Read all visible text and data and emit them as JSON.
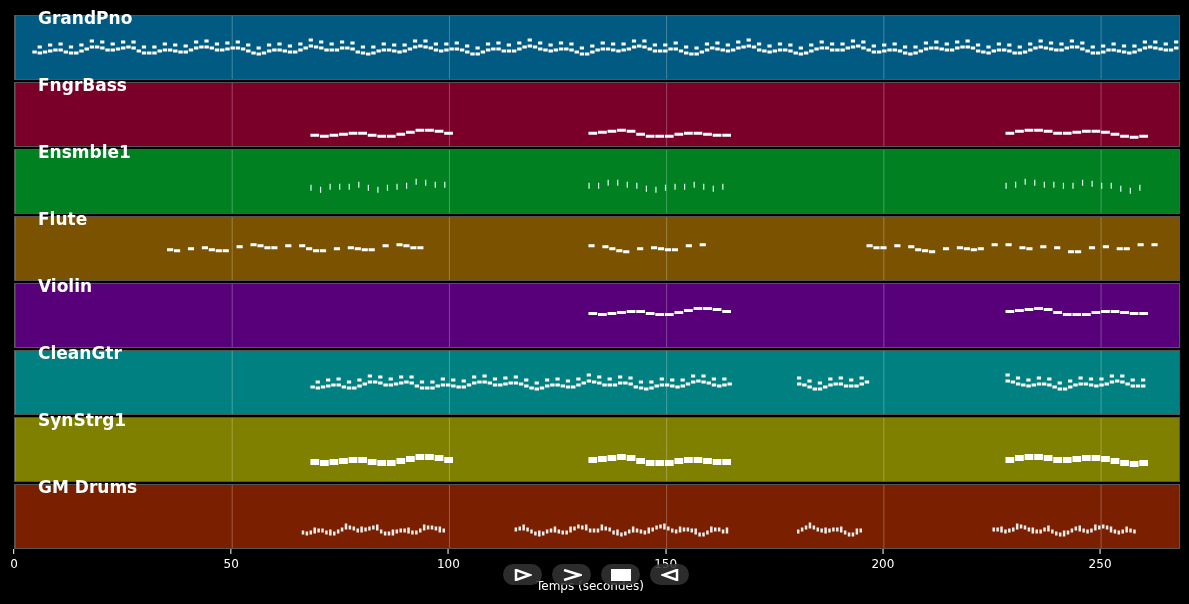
{
  "tracks": [
    {
      "name": "GrandPno",
      "color": "#005a82"
    },
    {
      "name": "FngrBass",
      "color": "#7a002a"
    },
    {
      "name": "Ensmble1",
      "color": "#008020"
    },
    {
      "name": "Flute",
      "color": "#7a5200"
    },
    {
      "name": "Violin",
      "color": "#57007a"
    },
    {
      "name": "CleanGtr",
      "color": "#008080"
    },
    {
      "name": "SynStrg1",
      "color": "#808000"
    },
    {
      "name": "GM Drums",
      "color": "#7a2000"
    }
  ],
  "x_axis": {
    "ticks": [
      "0",
      "50",
      "100",
      "150",
      "200",
      "250"
    ],
    "label": "Temps (secondes)"
  },
  "playback_buttons": [
    {
      "kind": "play"
    },
    {
      "kind": "forward"
    },
    {
      "kind": "stop"
    },
    {
      "kind": "back"
    }
  ]
}
